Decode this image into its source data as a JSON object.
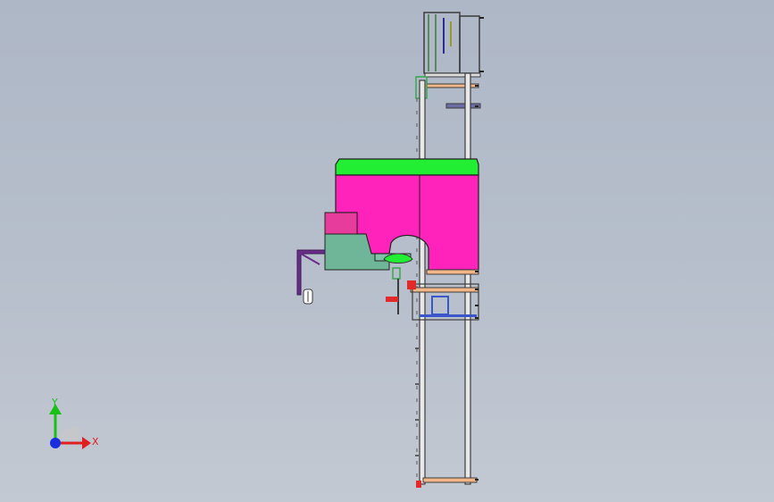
{
  "view": {
    "background_top": "#aeb7c6",
    "background_bottom": "#c3c9d2"
  },
  "model": {
    "colors": {
      "housing_top": "#22ee33",
      "housing_body": "#ff22bb",
      "housing_outline": "#222222",
      "base_block": "#6fb597",
      "base_block_top": "#e83c9c",
      "bracket": "#6a2d8a",
      "rail": "#3c3c3c",
      "rail_fill": "#dcdcdc",
      "crossbar": "#f3b689",
      "crossbar_dark": "#6c6ca6",
      "mechanism_blue": "#3a56c8",
      "mechanism_red": "#e22a2a",
      "mechanism_green": "#36a84a"
    }
  },
  "triad": {
    "x_label": "X",
    "y_label": "Y",
    "x_color": "#e02020",
    "y_color": "#18c018",
    "z_color": "#1a2ee0"
  }
}
